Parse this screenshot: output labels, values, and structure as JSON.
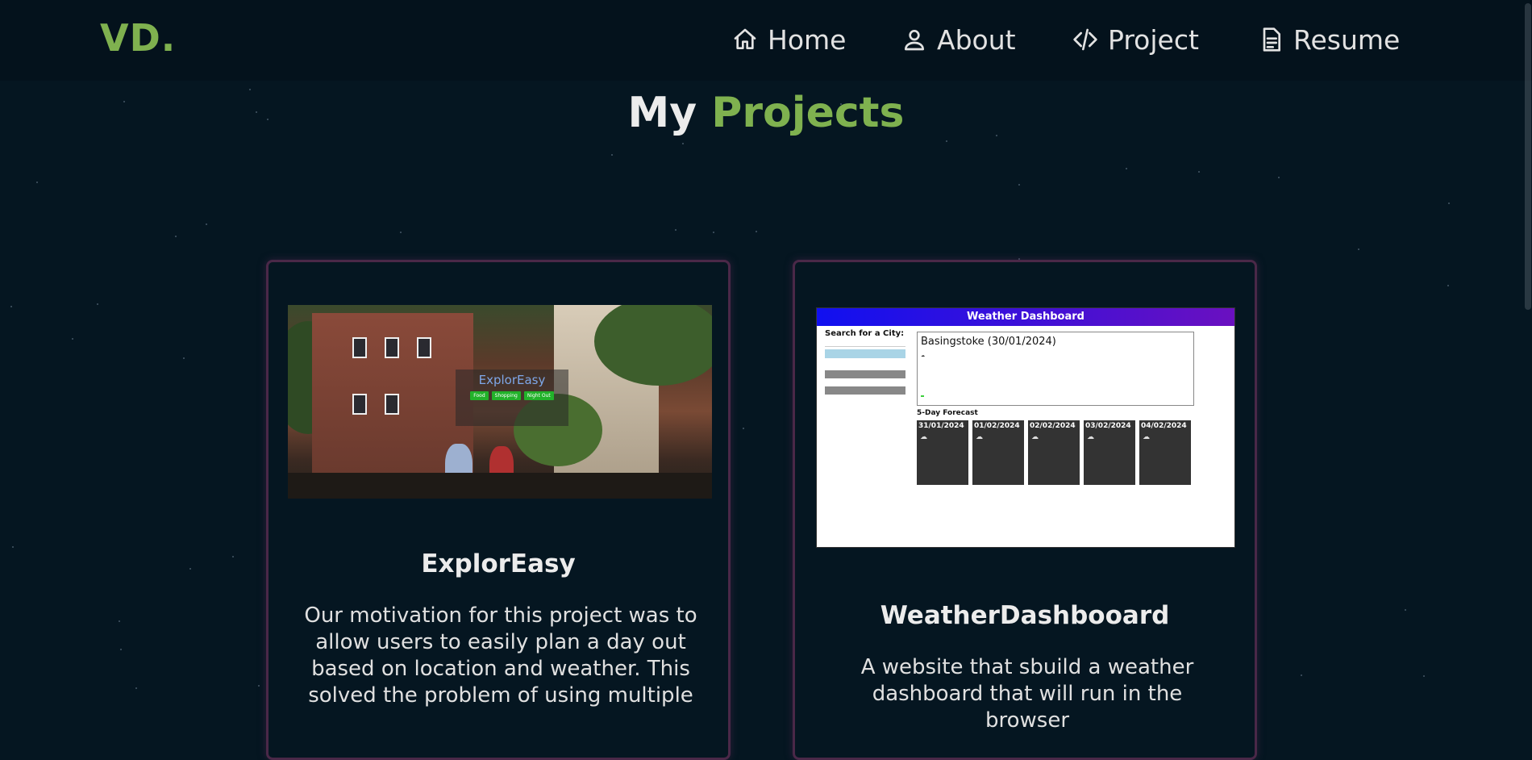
{
  "nav": {
    "logo": "VD.",
    "items": [
      {
        "label": "Home",
        "icon": "home-icon"
      },
      {
        "label": "About",
        "icon": "user-icon"
      },
      {
        "label": "Project",
        "icon": "code-icon"
      },
      {
        "label": "Resume",
        "icon": "document-icon"
      }
    ]
  },
  "heading": {
    "prefix": "My",
    "accent": "Projects"
  },
  "colors": {
    "accent": "#7fb14f",
    "background": "#051621",
    "card_border": "#4a2848"
  },
  "projects": [
    {
      "title": "ExplorEasy",
      "description": "Our motivation for this project was to allow users to easily plan a day out based on location and weather. This solved the problem of using multiple",
      "preview": {
        "app_title": "ExplorEasy",
        "buttons": [
          "Food",
          "Shopping",
          "Night Out"
        ]
      }
    },
    {
      "title": "WeatherDashbooard",
      "description": "A website that sbuild a weather dashboard that will run in the browser",
      "preview": {
        "header": "Weather Dashboard",
        "search_label": "Search for a City:",
        "current_city": "Basingstoke (30/01/2024)",
        "forecast_title": "5-Day Forecast",
        "forecast_dates": [
          "31/01/2024",
          "01/02/2024",
          "02/02/2024",
          "03/02/2024",
          "04/02/2024"
        ]
      }
    }
  ]
}
